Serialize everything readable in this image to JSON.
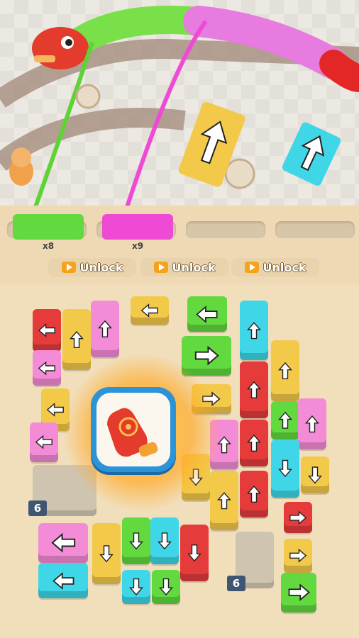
{
  "rack": {
    "spools": [
      {
        "count": "x8",
        "color": "#6fe03a"
      },
      {
        "count": "x9",
        "color": "#ee4ad4"
      }
    ],
    "unlock_buttons": [
      {
        "label": "Unlock"
      },
      {
        "label": "Unlock"
      },
      {
        "label": "Unlock"
      }
    ]
  },
  "locked_tiles": [
    {
      "count": "6"
    },
    {
      "count": "6"
    }
  ],
  "booster": {
    "icon": "glove-target-icon"
  },
  "colors": {
    "red": "#e53b3b",
    "yellow": "#f3c94a",
    "pink": "#f48bd6",
    "cyan": "#3fd7e8",
    "green": "#62d93f",
    "blue": "#2b93d8"
  }
}
